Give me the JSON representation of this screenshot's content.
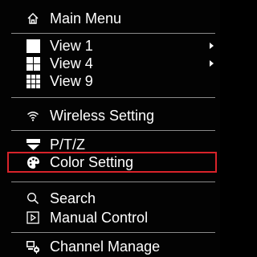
{
  "menu": {
    "items": [
      {
        "label": "Main Menu",
        "icon": "home-icon"
      },
      {
        "label": "View 1",
        "icon": "single-view-icon",
        "has_submenu": true
      },
      {
        "label": "View 4",
        "icon": "quad-view-icon",
        "has_submenu": true
      },
      {
        "label": "View 9",
        "icon": "nine-view-icon"
      },
      {
        "label": "Wireless Setting",
        "icon": "wifi-icon"
      },
      {
        "label": "P/T/Z",
        "icon": "ptz-icon"
      },
      {
        "label": "Color Setting",
        "icon": "palette-icon",
        "highlighted": true
      },
      {
        "label": "Search",
        "icon": "search-icon"
      },
      {
        "label": "Manual Control",
        "icon": "manual-control-icon"
      },
      {
        "label": "Channel Manage",
        "icon": "channel-manage-icon"
      }
    ],
    "highlight_color": "#d8232a"
  }
}
